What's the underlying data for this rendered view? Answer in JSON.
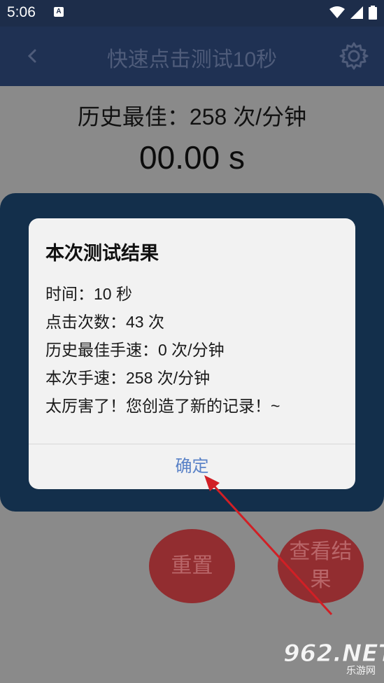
{
  "statusbar": {
    "time": "5:06",
    "notification_icon_letter": "A",
    "icons": [
      "wifi-icon",
      "signal-icon",
      "battery-icon"
    ]
  },
  "appbar": {
    "title": "快速点击测试10秒",
    "back_icon": "chevron-left-icon",
    "settings_icon": "gear-icon"
  },
  "main": {
    "best_record": "历史最佳：258 次/分钟",
    "timer": "00.00 s"
  },
  "buttons": {
    "reset": "重置",
    "view_result": "查看结果"
  },
  "dialog": {
    "title": "本次测试结果",
    "lines": [
      "时间：10 秒",
      "点击次数：43 次",
      "历史最佳手速：0 次/分钟",
      "本次手速：258 次/分钟",
      "太厉害了！您创造了新的记录！~"
    ],
    "ok": "确定"
  },
  "watermark": {
    "number": "962",
    "suffix": ".NET",
    "sub": "乐游网"
  },
  "colors": {
    "appbar": "#1f3153",
    "panel": "#132f4b",
    "button": "#922d30",
    "dialog_ok": "#5a82c7",
    "annotation_arrow": "#d11f25"
  }
}
